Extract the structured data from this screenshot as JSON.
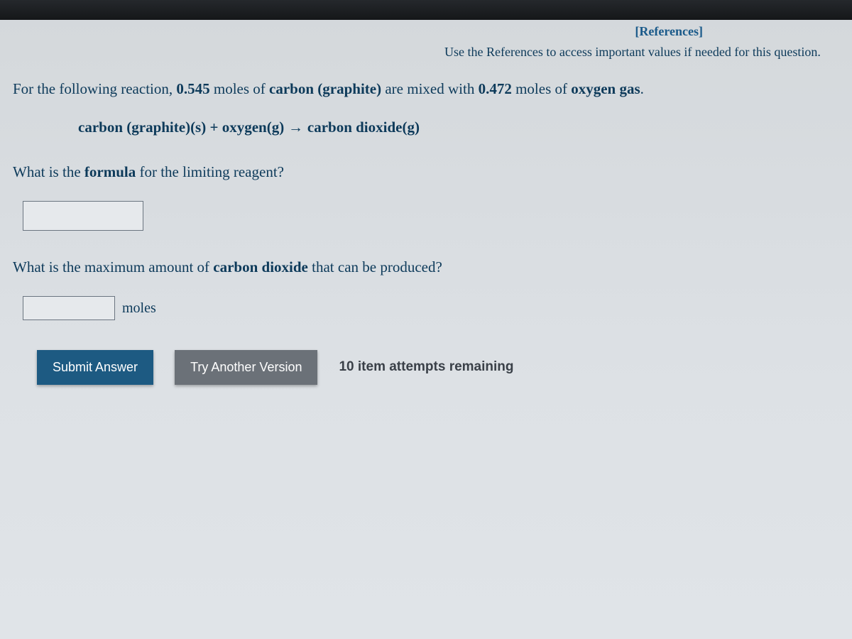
{
  "header": {
    "references_link": "[References]",
    "hint_text": "Use the References to access important values if needed for this question."
  },
  "problem": {
    "intro_prefix": "For the following reaction, ",
    "moles_carbon": "0.545",
    "intro_mid1": " moles of ",
    "reactant1": "carbon (graphite)",
    "intro_mid2": " are mixed with ",
    "moles_oxygen": "0.472",
    "intro_mid3": " moles of ",
    "reactant2": "oxygen gas",
    "intro_suffix": ".",
    "equation": {
      "lhs1": "carbon (graphite)(s)",
      "plus": " + ",
      "lhs2": "oxygen(g)",
      "arrow": " → ",
      "rhs": "carbon dioxide(g)"
    }
  },
  "q1": {
    "prefix": "What is the ",
    "bold": "formula",
    "suffix": " for the limiting reagent?"
  },
  "q2": {
    "prefix": "What is the maximum amount of ",
    "bold": "carbon dioxide",
    "suffix": " that can be produced?",
    "unit": "moles"
  },
  "actions": {
    "submit": "Submit Answer",
    "try_another": "Try Another Version",
    "attempts": "10 item attempts remaining"
  }
}
